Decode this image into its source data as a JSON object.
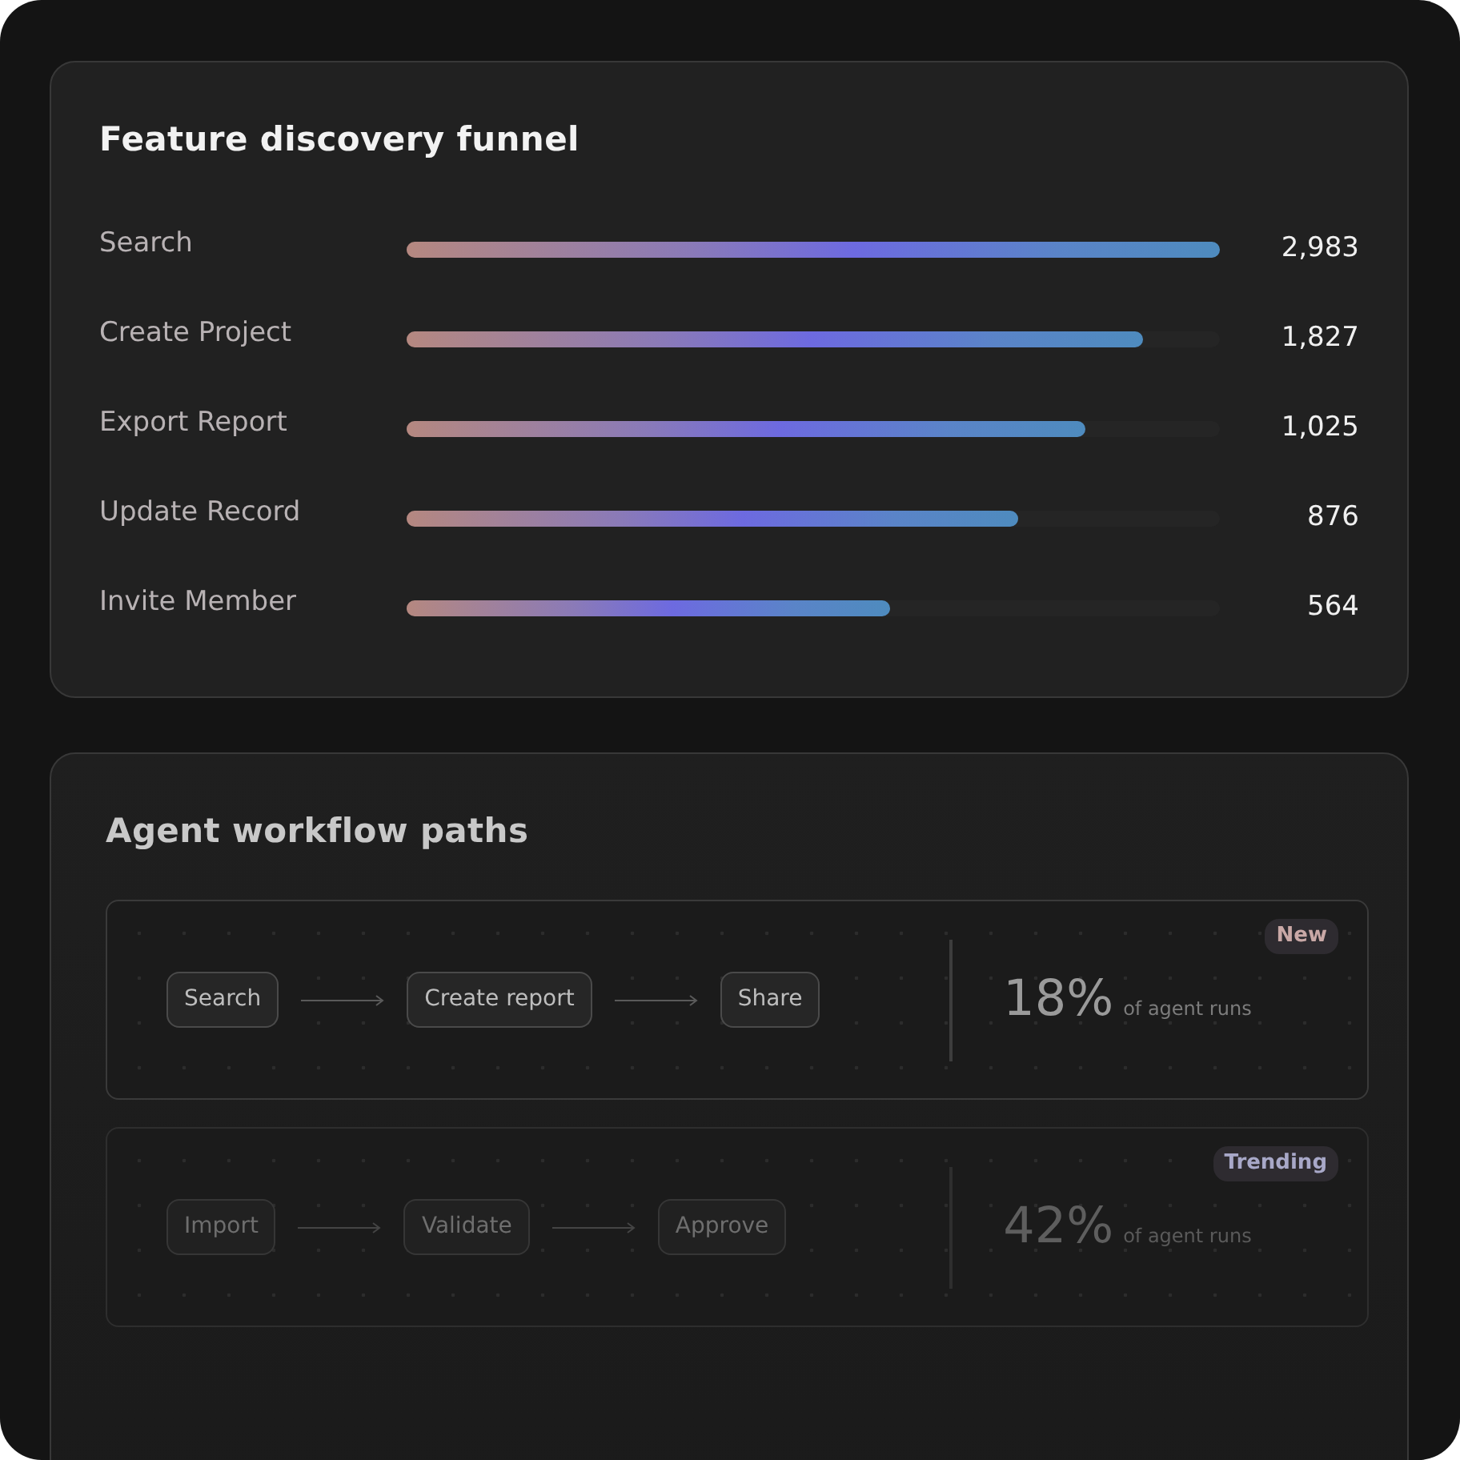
{
  "funnel": {
    "title": "Feature discovery funnel",
    "rows": [
      {
        "label": "Search",
        "level": 1.0,
        "value": "2,983"
      },
      {
        "label": "Create Project",
        "level": 0.906,
        "value": "1,827"
      },
      {
        "label": "Export Report",
        "level": 0.835,
        "value": "1,025"
      },
      {
        "label": "Update Record",
        "level": 0.752,
        "value": "876"
      },
      {
        "label": "Invite Member",
        "level": 0.594,
        "value": "564"
      }
    ]
  },
  "workflows": {
    "title": "Agent workflow paths",
    "paths": [
      {
        "dimmed": false,
        "steps": [
          "Search",
          "Create report",
          "Share"
        ],
        "share": "18%",
        "caption": "of agent runs",
        "badge": "New",
        "color": "#c9a8a6"
      },
      {
        "dimmed": true,
        "steps": [
          "Import",
          "Validate",
          "Approve"
        ],
        "share": "42%",
        "caption": "of agent runs",
        "badge": "Trending",
        "color": "#a8a8c8"
      }
    ]
  }
}
